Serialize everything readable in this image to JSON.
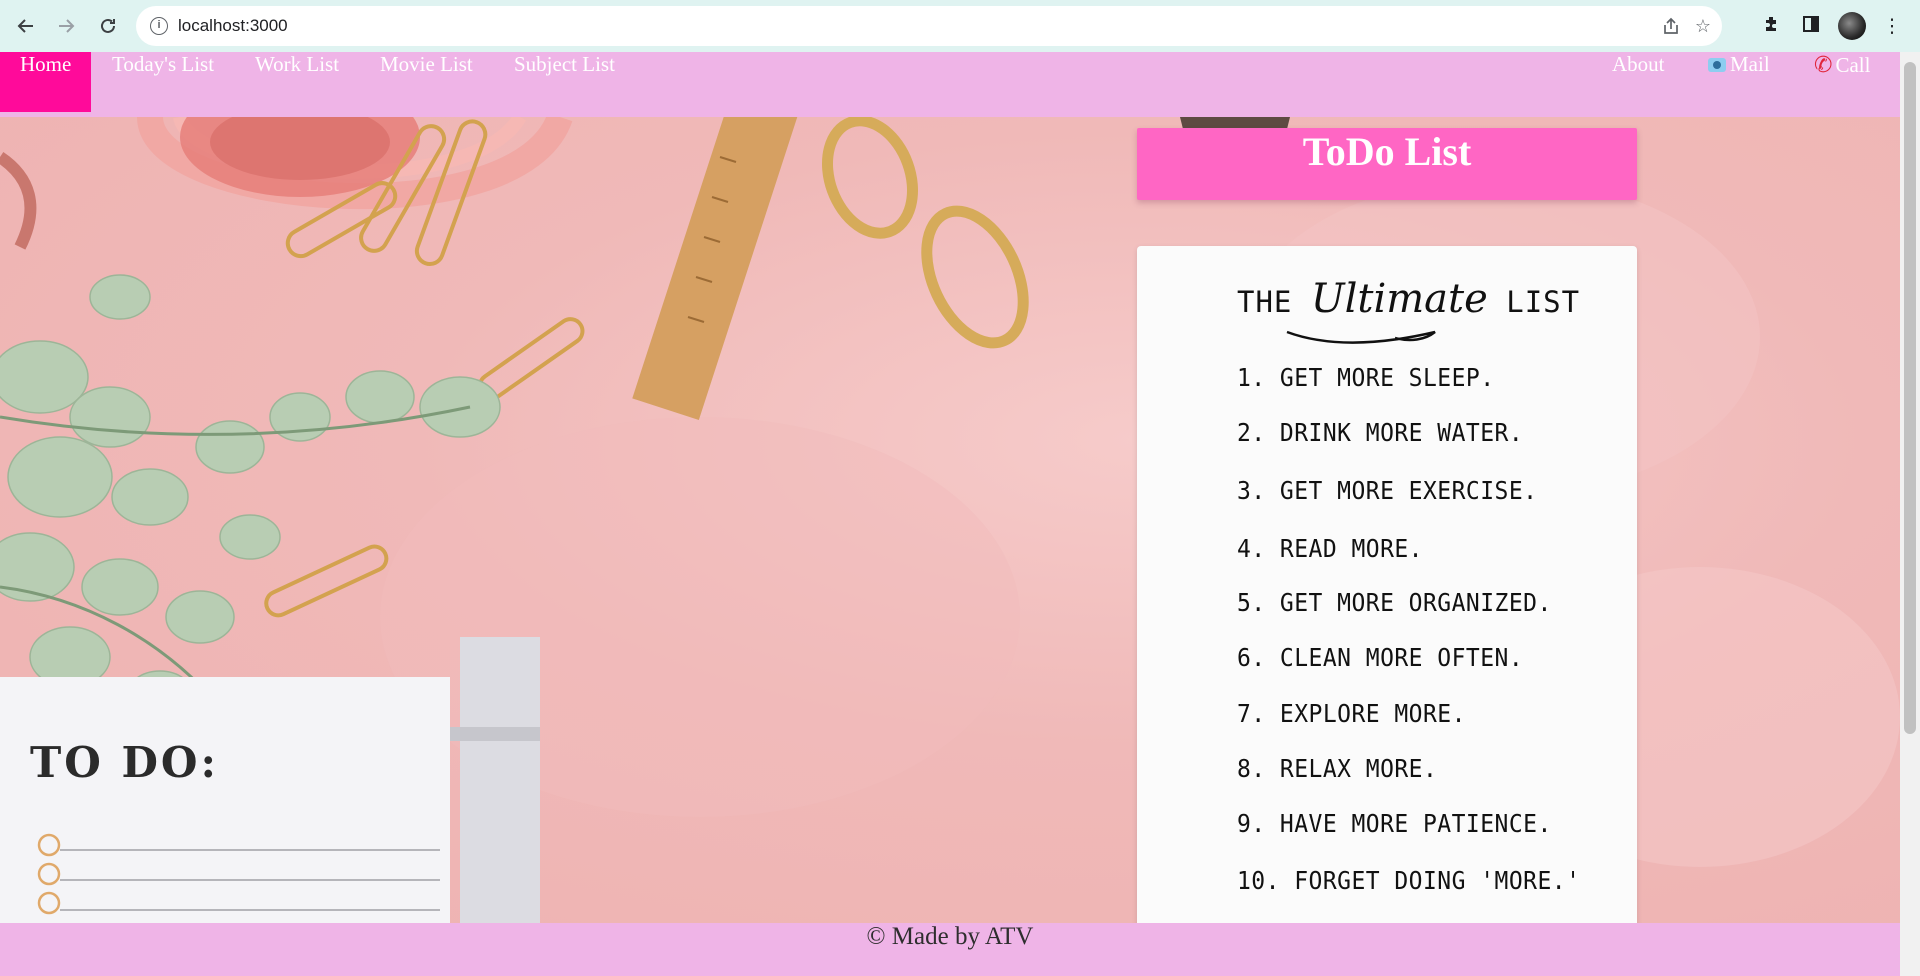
{
  "browser": {
    "url": "localhost:3000"
  },
  "navbar": {
    "links": [
      {
        "label": "Home",
        "active": true
      },
      {
        "label": "Today's List"
      },
      {
        "label": "Work List"
      },
      {
        "label": "Movie List"
      },
      {
        "label": "Subject List"
      }
    ],
    "right_links": [
      {
        "label": "About"
      },
      {
        "label": "Mail",
        "icon": "camera-icon"
      },
      {
        "label": "Call",
        "icon": "phone-icon"
      }
    ]
  },
  "main": {
    "banner_title": "ToDo List",
    "notepad_heading": "TO DO:",
    "list_card": {
      "title_prefix": "THE",
      "title_fancy": "Ultimate",
      "title_suffix": "LIST",
      "items": [
        "1. GET MORE SLEEP.",
        "2. DRINK MORE WATER.",
        "3. GET MORE EXERCISE.",
        "4. READ MORE.",
        "5. GET MORE ORGANIZED.",
        "6. CLEAN MORE OFTEN.",
        "7. EXPLORE MORE.",
        "8. RELAX MORE.",
        "9. HAVE MORE PATIENCE.",
        "10. FORGET DOING 'MORE.'"
      ]
    }
  },
  "footer": {
    "text": "© Made by ATV"
  },
  "colors": {
    "navbar": "#efb4e7",
    "active_nav": "#ff0a9a",
    "banner": "#ff66c4"
  }
}
